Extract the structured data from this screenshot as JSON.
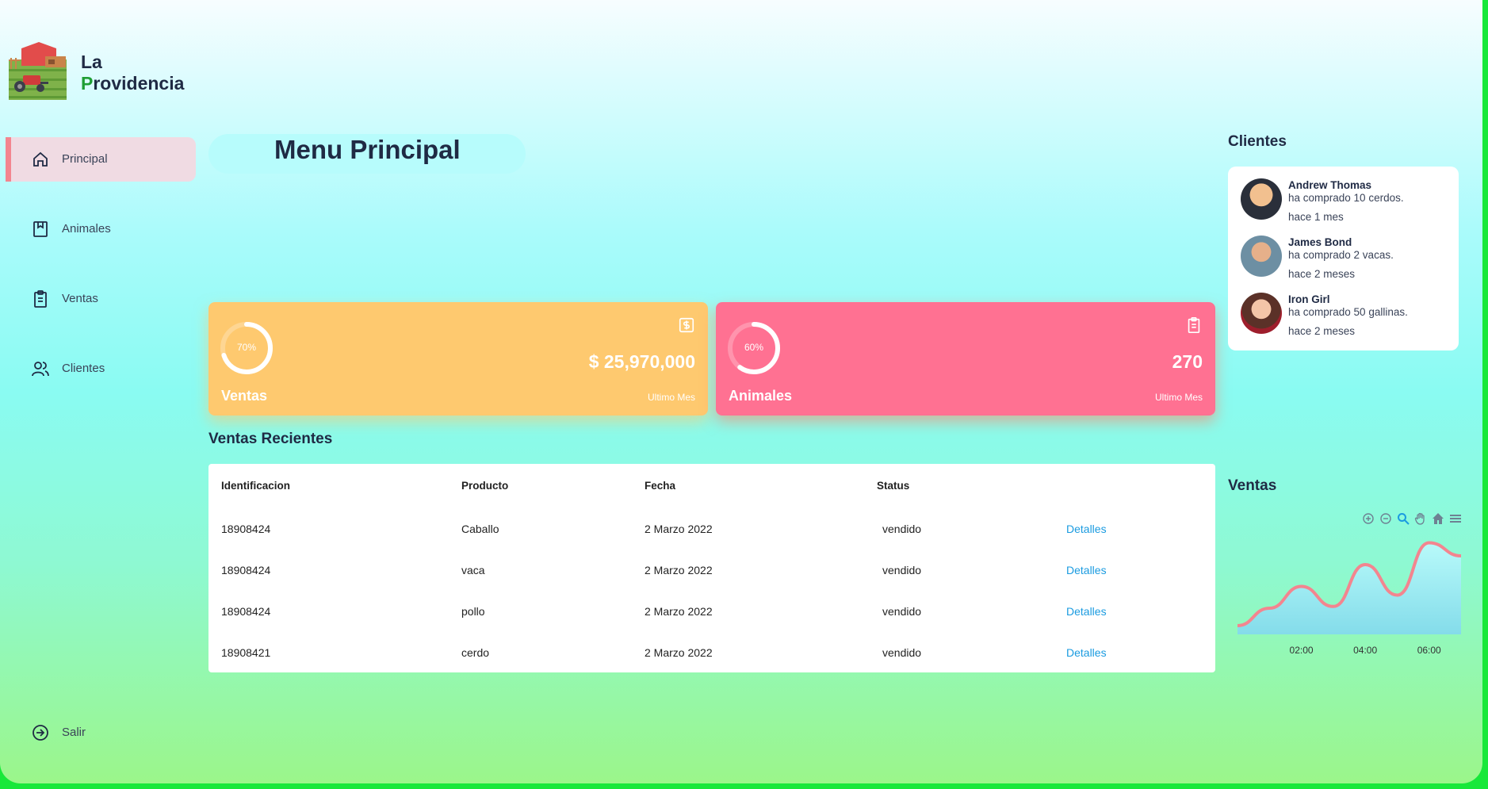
{
  "brand": {
    "line1": "La",
    "line2_first": "P",
    "line2_rest": "rovidencia"
  },
  "sidebar": {
    "items": [
      {
        "label": "Principal",
        "icon": "home-icon"
      },
      {
        "label": "Animales",
        "icon": "bookmark-box-icon"
      },
      {
        "label": "Ventas",
        "icon": "clipboard-icon"
      },
      {
        "label": "Clientes",
        "icon": "users-icon"
      }
    ],
    "logout": {
      "label": "Salir",
      "icon": "sign-in-icon"
    }
  },
  "main": {
    "title": "Menu Principal"
  },
  "cards": [
    {
      "name": "Ventas",
      "percent": "70%",
      "percent_value": 0.7,
      "amount": "$ 25,970,000",
      "sub": "Ultimo Mes",
      "color": "#fec96f"
    },
    {
      "name": "Animales",
      "percent": "60%",
      "percent_value": 0.6,
      "amount": "270",
      "sub": "Ultimo Mes",
      "color": "#ff7192"
    }
  ],
  "recent": {
    "title": "Ventas Recientes",
    "headers": [
      "Identificacion",
      "Producto",
      "Fecha",
      "Status"
    ],
    "rows": [
      {
        "id": "18908424",
        "product": "Caballo",
        "date": "2 Marzo 2022",
        "status": "vendido",
        "action": "Detalles"
      },
      {
        "id": "18908424",
        "product": "vaca",
        "date": "2 Marzo 2022",
        "status": "vendido",
        "action": "Detalles"
      },
      {
        "id": "18908424",
        "product": "pollo",
        "date": "2 Marzo 2022",
        "status": "vendido",
        "action": "Detalles"
      },
      {
        "id": "18908421",
        "product": "cerdo",
        "date": "2 Marzo 2022",
        "status": "vendido",
        "action": "Detalles"
      }
    ]
  },
  "clients": {
    "title": "Clientes",
    "items": [
      {
        "name": "Andrew Thomas",
        "message": "ha comprado 10 cerdos.",
        "time": "hace 1 mes"
      },
      {
        "name": "James Bond",
        "message": "ha comprado 2 vacas.",
        "time": "hace 2 meses"
      },
      {
        "name": "Iron Girl",
        "message": "ha comprado 50 gallinas.",
        "time": "hace 2 meses"
      }
    ]
  },
  "sales_chart": {
    "title": "Ventas",
    "tools": [
      "zoom-in-icon",
      "zoom-out-icon",
      "selection-zoom-icon",
      "pan-hand-icon",
      "reset-home-icon",
      "menu-icon"
    ]
  },
  "chart_data": {
    "type": "area",
    "title": "",
    "x": [
      "00:00",
      "01:00",
      "02:00",
      "03:00",
      "04:00",
      "05:00",
      "06:00",
      "06:30"
    ],
    "x_tick_labels": [
      "02:00",
      "04:00",
      "06:00"
    ],
    "series": [
      {
        "values": [
          10,
          30,
          55,
          32,
          80,
          45,
          105,
          90
        ]
      }
    ],
    "ylim": [
      0,
      120
    ],
    "grid": false,
    "line_color": "#f3858f",
    "fill_color": "#9ef0f0"
  }
}
